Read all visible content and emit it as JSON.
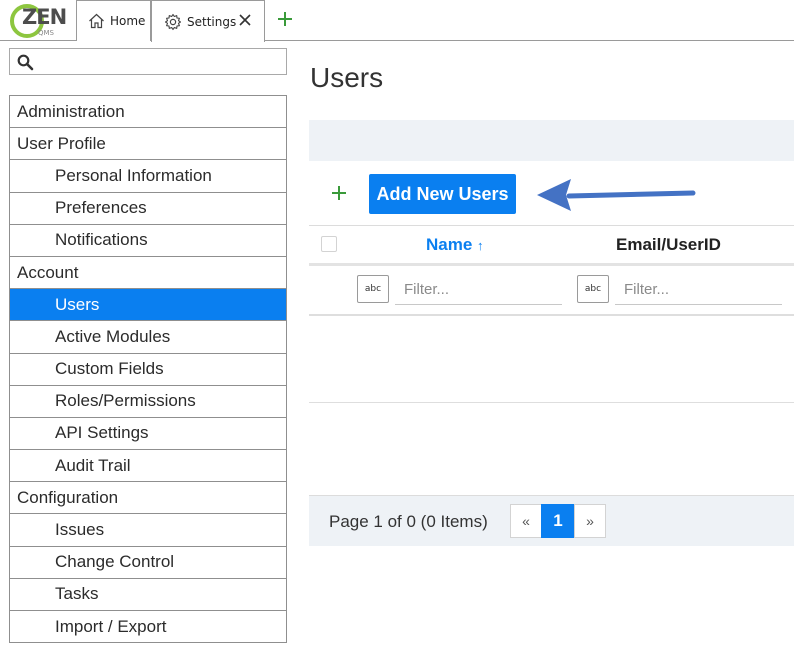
{
  "app": {
    "logo_text": "ZEN",
    "logo_sub": "QMS"
  },
  "tabs": [
    {
      "label": "Home",
      "icon": "home-icon"
    },
    {
      "label": "Settings",
      "icon": "gear-icon",
      "closable": true
    }
  ],
  "sidebar": {
    "search_placeholder": "",
    "items": [
      {
        "label": "Administration",
        "level": "top"
      },
      {
        "label": "User Profile",
        "level": "top"
      },
      {
        "label": "Personal Information",
        "level": "sub"
      },
      {
        "label": "Preferences",
        "level": "sub"
      },
      {
        "label": "Notifications",
        "level": "sub"
      },
      {
        "label": "Account",
        "level": "top"
      },
      {
        "label": "Users",
        "level": "sub",
        "active": true
      },
      {
        "label": "Active Modules",
        "level": "sub"
      },
      {
        "label": "Custom Fields",
        "level": "sub"
      },
      {
        "label": "Roles/Permissions",
        "level": "sub"
      },
      {
        "label": "API Settings",
        "level": "sub"
      },
      {
        "label": "Audit Trail",
        "level": "sub"
      },
      {
        "label": "Configuration",
        "level": "top"
      },
      {
        "label": "Issues",
        "level": "sub"
      },
      {
        "label": "Change Control",
        "level": "sub"
      },
      {
        "label": "Tasks",
        "level": "sub"
      },
      {
        "label": "Import / Export",
        "level": "sub"
      }
    ]
  },
  "main": {
    "title": "Users",
    "add_button": "Add New Users",
    "columns": [
      {
        "label": "Name",
        "sorted": "asc",
        "sort_glyph": "↑"
      },
      {
        "label": "Email/UserID"
      }
    ],
    "filter_icon_text": "abc",
    "filters": [
      {
        "placeholder": "Filter..."
      },
      {
        "placeholder": "Filter..."
      }
    ],
    "pager": {
      "info": "Page 1 of 0 (0 Items)",
      "prev": "«",
      "current": "1",
      "next": "»"
    }
  },
  "colors": {
    "accent": "#0a7ff0",
    "logo_green": "#8dc63f",
    "add_plus_green": "#3a9a3a",
    "annotation_arrow": "#4472c4"
  }
}
